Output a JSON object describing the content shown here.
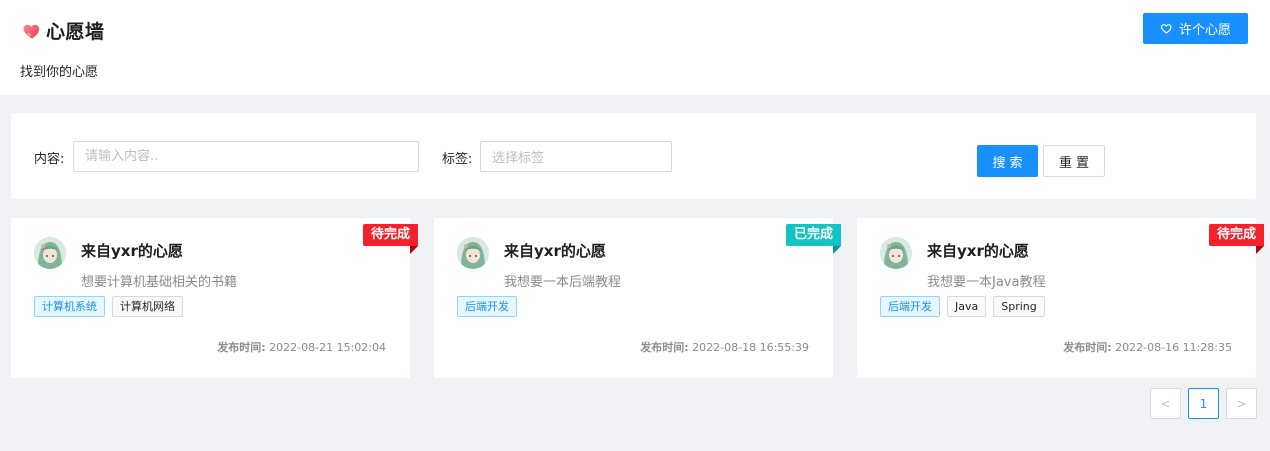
{
  "header": {
    "title": "心愿墙",
    "subtitle": "找到你的心愿",
    "make_wish_label": "许个心愿"
  },
  "search": {
    "content_label": "内容:",
    "content_placeholder": "请输入内容..",
    "content_value": "",
    "tags_label": "标签:",
    "tags_placeholder": "选择标签",
    "search_label": "搜索",
    "reset_label": "重置"
  },
  "cards": [
    {
      "title": "来自yxr的心愿",
      "desc": "想要计算机基础相关的书籍",
      "status": "待完成",
      "status_color": "#f5222d",
      "tags": [
        "计算机系统",
        "计算机网络"
      ],
      "publish_label": "发布时间:",
      "publish_time": "2022-08-21 15:02:04"
    },
    {
      "title": "来自yxr的心愿",
      "desc": "我想要一本后端教程",
      "status": "已完成",
      "status_color": "#13c2c2",
      "tags": [
        "后端开发"
      ],
      "publish_label": "发布时间:",
      "publish_time": "2022-08-18 16:55:39"
    },
    {
      "title": "来自yxr的心愿",
      "desc": "我想要一本Java教程",
      "status": "待完成",
      "status_color": "#f5222d",
      "tags": [
        "后端开发",
        "Java",
        "Spring"
      ],
      "publish_label": "发布时间:",
      "publish_time": "2022-08-16 11:28:35"
    }
  ],
  "pagination": {
    "prev": "<",
    "current": "1",
    "next": ">"
  },
  "colors": {
    "primary": "#1890ff",
    "pending": "#f5222d",
    "done": "#13c2c2"
  }
}
